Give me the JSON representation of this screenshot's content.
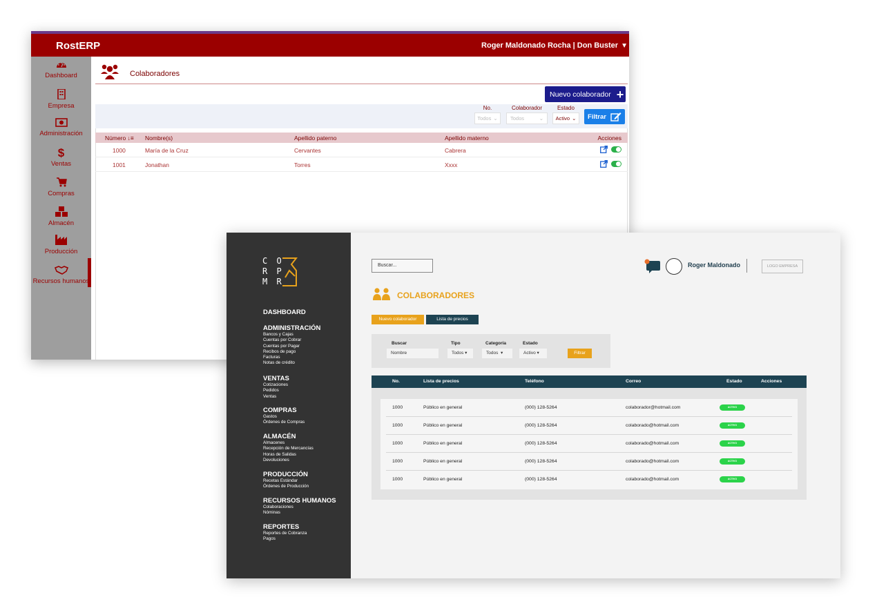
{
  "rosterp": {
    "brand": "RostERP",
    "user": "Roger Maldonado Rocha | Don Buster",
    "sidebar": [
      {
        "label": "Dashboard",
        "icon": "dashboard-gauge-icon"
      },
      {
        "label": "Empresa",
        "icon": "building-icon"
      },
      {
        "label": "Administración",
        "icon": "money-icon"
      },
      {
        "label": "Ventas",
        "icon": "dollar-icon"
      },
      {
        "label": "Compras",
        "icon": "cart-icon"
      },
      {
        "label": "Almacén",
        "icon": "boxes-icon"
      },
      {
        "label": "Producción",
        "icon": "factory-icon"
      },
      {
        "label": "Recursos humanos",
        "icon": "handshake-icon"
      }
    ],
    "page_title": "Colaboradores",
    "new_button": "Nuevo colaborador",
    "filters": {
      "no_label": "No.",
      "no_value": "Todos",
      "colaborador_label": "Colaborador",
      "colaborador_value": "Todos",
      "estado_label": "Estado",
      "estado_value": "Activo",
      "filter_button": "Filtrar"
    },
    "table": {
      "headers": [
        "Número",
        "Nombre(s)",
        "Apellido paterno",
        "Apellido materno",
        "Acciones"
      ],
      "rows": [
        {
          "numero": "1000",
          "nombre": "María de la Cruz",
          "paterno": "Cervantes",
          "materno": "Cabrera"
        },
        {
          "numero": "1001",
          "nombre": "Jonathan",
          "paterno": "Torres",
          "materno": "Xxxx"
        }
      ]
    }
  },
  "corpmr": {
    "logo_text": "C O\nR P\nM R",
    "nav": [
      {
        "title": "DASHBOARD",
        "items": []
      },
      {
        "title": "ADMINISTRACIÓN",
        "items": [
          "Bancos y Cajas",
          "Cuentas por Cobrar",
          "Cuentas por Pagar",
          "Recibos de pago",
          "Facturas",
          "Notas de crédito"
        ]
      },
      {
        "title": "VENTAS",
        "items": [
          "Cotizaciones",
          "Pedidos",
          "Ventas"
        ]
      },
      {
        "title": "COMPRAS",
        "items": [
          "Gastos",
          "Órdenes de Compras"
        ]
      },
      {
        "title": "ALMACÉN",
        "items": [
          "Almacenes",
          "Recepción de Mercancías",
          "Horas de Salidas",
          "Devoluciones"
        ]
      },
      {
        "title": "PRODUCCIÓN",
        "items": [
          "Recetas Estándar",
          "Órdenes de Producción"
        ]
      },
      {
        "title": "RECURSOS HUMANOS",
        "items": [
          "Colaboraciones",
          "Nóminas"
        ]
      },
      {
        "title": "REPORTES",
        "items": [
          "Reportes de Cobranza",
          "Pagos"
        ]
      }
    ],
    "search_placeholder": "Buscar...",
    "user_name": "Roger Maldonado",
    "logo_empresa": "LOGO EMPRESA",
    "page_title": "COLABORADORES",
    "btn_new": "Nuevo colaborador",
    "btn_prices": "Lista de precios",
    "filters": {
      "buscar_label": "Buscar",
      "buscar_value": "Nombre",
      "tipo_label": "Tipo",
      "tipo_value": "Todos",
      "categoria_label": "Categoría",
      "categoria_value": "Todos",
      "estado_label": "Estado",
      "estado_value": "Activo",
      "filter_button": "Filtrar"
    },
    "table": {
      "headers": [
        "No.",
        "Lista de precios",
        "Teléfono",
        "Correo",
        "Estado",
        "Acciones"
      ],
      "rows": [
        {
          "no": "1000",
          "lista": "Público en general",
          "tel": "(000) 128-5264",
          "correo": "colaborador@hotmail.com",
          "estado": "ACTIVO"
        },
        {
          "no": "1000",
          "lista": "Público en general",
          "tel": "(000) 128-5264",
          "correo": "colaborado@hotmail.com",
          "estado": "ACTIVO"
        },
        {
          "no": "1000",
          "lista": "Público en general",
          "tel": "(000) 128-5264",
          "correo": "colaborado@hotmail.com",
          "estado": "ACTIVO"
        },
        {
          "no": "1000",
          "lista": "Público en general",
          "tel": "(000) 128-5264",
          "correo": "colaborado@hotmail.com",
          "estado": "ACTIVO"
        },
        {
          "no": "1000",
          "lista": "Público en general",
          "tel": "(000) 128-5264",
          "correo": "colaborado@hotmail.com",
          "estado": "ACTIVO"
        }
      ]
    }
  },
  "colors": {
    "rost_red": "#9b0000",
    "corp_dark": "#333333",
    "corp_orange": "#e8a21c",
    "corp_teal": "#1d4352",
    "active_green": "#2bd34a"
  }
}
